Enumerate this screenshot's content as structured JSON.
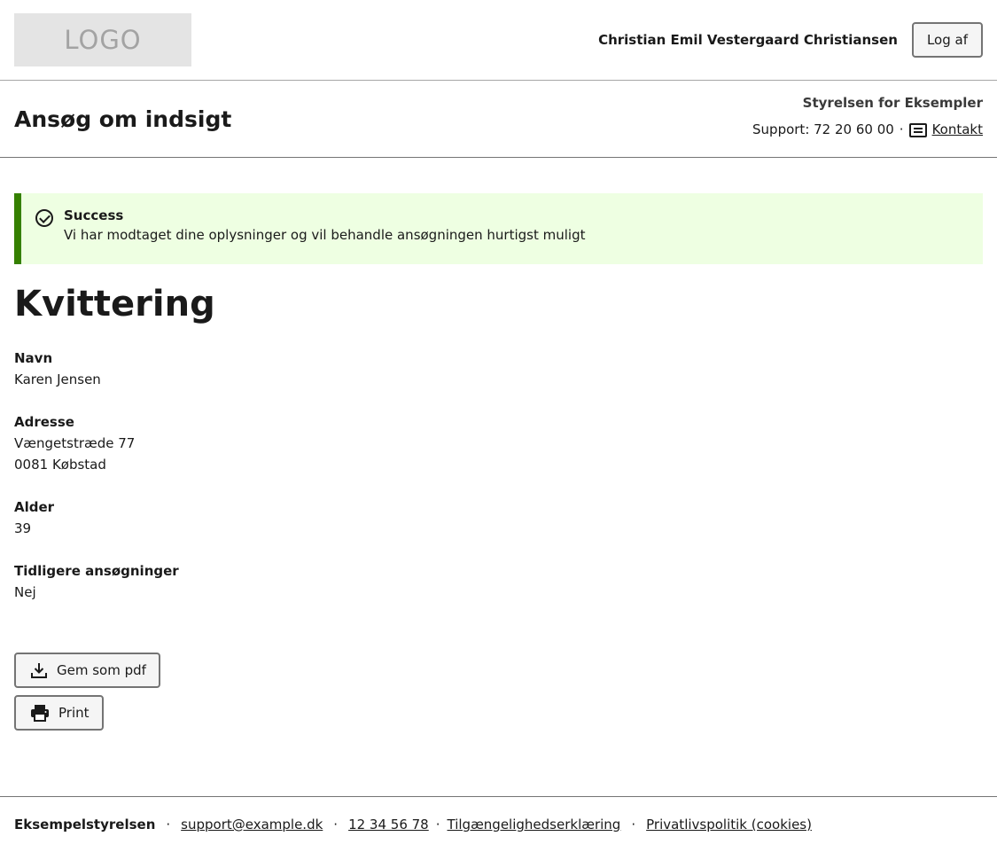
{
  "header": {
    "logo_text": "LOGO",
    "user_name": "Christian Emil Vestergaard Christiansen",
    "logout_label": "Log af"
  },
  "subheader": {
    "title": "Ansøg om indsigt",
    "authority": "Styrelsen for Eksempler",
    "support_text": "Support: 72 20 60 00",
    "separator": "·",
    "contact_label": "Kontakt"
  },
  "alert": {
    "title": "Success",
    "message": "Vi har modtaget dine oplysninger og vil behandle ansøgningen hurtigst muligt"
  },
  "receipt": {
    "title": "Kvittering",
    "fields": [
      {
        "label": "Navn",
        "lines": [
          "Karen Jensen"
        ]
      },
      {
        "label": "Adresse",
        "lines": [
          "Vængetstræde 77",
          "0081 Købstad"
        ]
      },
      {
        "label": "Alder",
        "lines": [
          "39"
        ]
      },
      {
        "label": "Tidligere ansøgninger",
        "lines": [
          "Nej"
        ]
      }
    ]
  },
  "actions": {
    "pdf_label": "Gem som pdf",
    "print_label": "Print"
  },
  "footer": {
    "org": "Eksempelstyrelsen",
    "separator": "·",
    "email": "support@example.dk",
    "phone": "12 34 56 78",
    "accessibility": "Tilgængelighedserklæring",
    "privacy": "Privatlivspolitik (cookies)"
  }
}
